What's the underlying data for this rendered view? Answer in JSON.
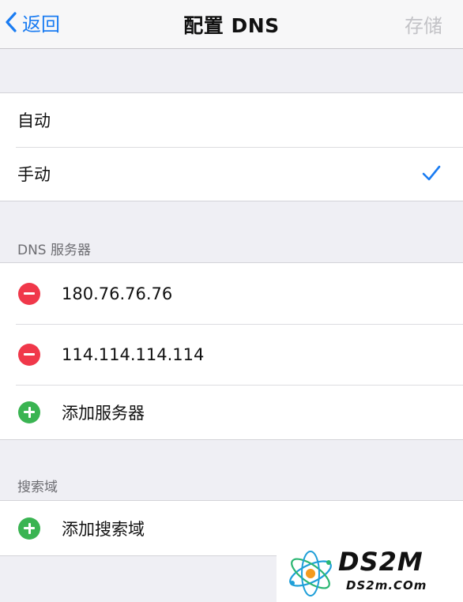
{
  "navbar": {
    "back_label": "返回",
    "title": "配置 DNS",
    "save_label": "存储"
  },
  "mode_group": {
    "items": [
      {
        "label": "自动",
        "checked": false
      },
      {
        "label": "手动",
        "checked": true
      }
    ]
  },
  "dns_section": {
    "header": "DNS 服务器",
    "servers": [
      "180.76.76.76",
      "114.114.114.114"
    ],
    "add_label": "添加服务器"
  },
  "search_section": {
    "header": "搜索域",
    "add_label": "添加搜索域"
  },
  "watermark": {
    "title": "DS2M",
    "url": "DS2m.COm"
  },
  "colors": {
    "accent": "#1a7cf2",
    "delete": "#f0384a",
    "add": "#3ab452",
    "disabled": "#c3c3c7"
  }
}
